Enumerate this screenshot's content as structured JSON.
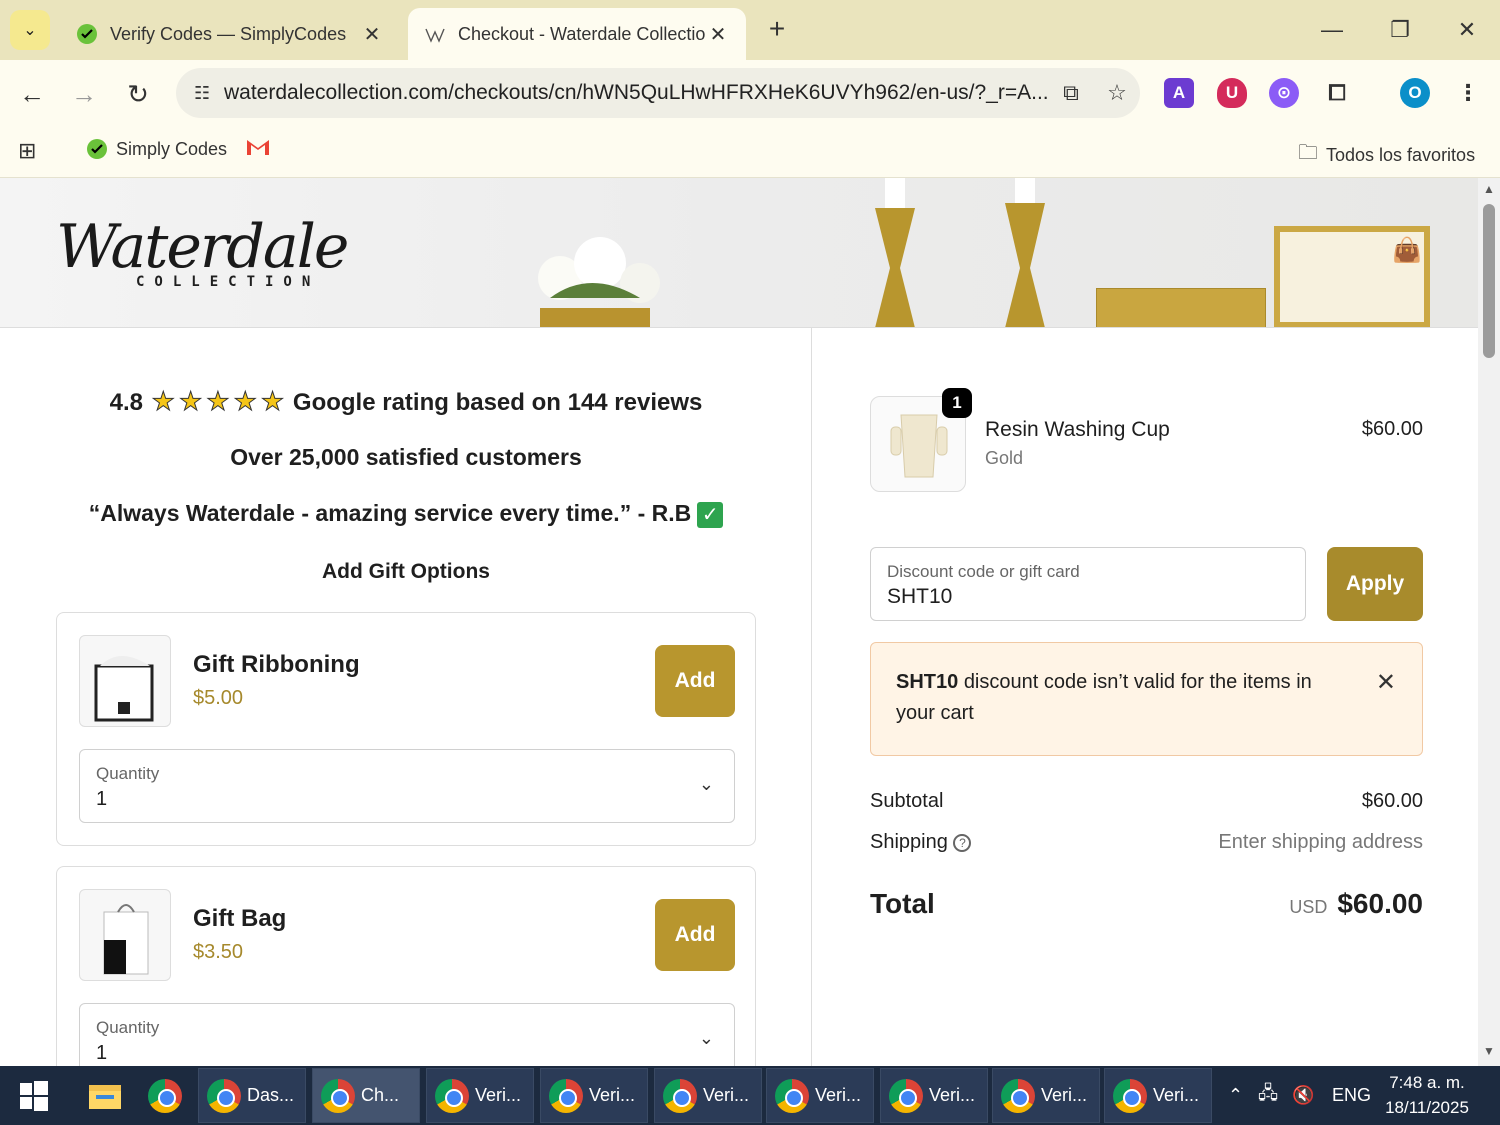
{
  "browser": {
    "tabs": [
      {
        "title": "Verify Codes — SimplyCodes",
        "active": false
      },
      {
        "title": "Checkout - Waterdale Collection",
        "active": true
      }
    ],
    "url": "waterdalecollection.com/checkouts/cn/hWN5QuLHwHFRXHeK6UVYh962/en-us/?_r=A...",
    "bookmarks": {
      "simply_codes": "Simply Codes",
      "all_favorites": "Todos los favoritos"
    },
    "profile_initial": "O"
  },
  "page": {
    "logo_script": "Waterdale",
    "logo_sub": "COLLECTION",
    "rating_prefix": "4.8",
    "rating_suffix": "Google rating based on 144 reviews",
    "customers": "Over 25,000 satisfied customers",
    "testimonial": "“Always Waterdale - amazing service every time.” - R.B",
    "gift_options_heading": "Add Gift Options",
    "gifts": [
      {
        "name": "Gift Ribboning",
        "price": "$5.00",
        "add_label": "Add",
        "qty_label": "Quantity",
        "qty_value": "1"
      },
      {
        "name": "Gift Bag",
        "price": "$3.50",
        "add_label": "Add",
        "qty_label": "Quantity",
        "qty_value": "1"
      }
    ]
  },
  "order": {
    "item": {
      "name": "Resin Washing Cup",
      "variant": "Gold",
      "price": "$60.00",
      "quantity": "1"
    },
    "discount": {
      "label": "Discount code or gift card",
      "value": "SHT10",
      "apply_label": "Apply"
    },
    "alert": {
      "code": "SHT10",
      "message": "discount code isn’t valid for the items in your cart"
    },
    "subtotal_label": "Subtotal",
    "subtotal_value": "$60.00",
    "shipping_label": "Shipping",
    "shipping_value": "Enter shipping address",
    "total_label": "Total",
    "total_currency": "USD",
    "total_value": "$60.00"
  },
  "taskbar": {
    "apps": [
      {
        "label": "Das...",
        "badge": ""
      },
      {
        "label": "Ch...",
        "badge": "O"
      },
      {
        "label": "Veri...",
        "badge": ""
      },
      {
        "label": "Veri...",
        "badge": ""
      },
      {
        "label": "Veri...",
        "badge": "k"
      },
      {
        "label": "Veri...",
        "badge": "m"
      },
      {
        "label": "Veri...",
        "badge": "L"
      },
      {
        "label": "Veri...",
        "badge": "B"
      },
      {
        "label": "Veri...",
        "badge": "d"
      }
    ],
    "lang": "ENG",
    "time": "7:48 a. m.",
    "date": "18/11/2025"
  },
  "colors": {
    "accent_gold": "#b8962e",
    "alert_bg": "#fff4e6",
    "tab_strip": "#eae4bd"
  }
}
